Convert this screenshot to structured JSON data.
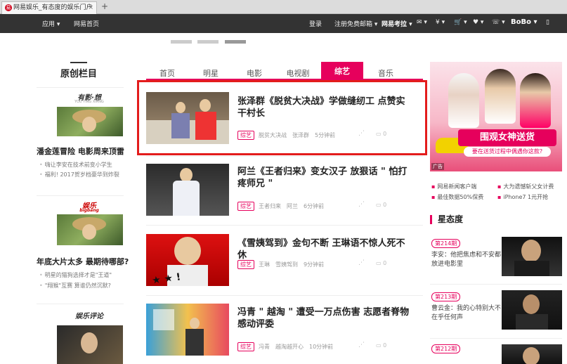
{
  "browser": {
    "tab_title": "网易娱乐_有态度的娱乐门户",
    "close": "×",
    "new_tab": "+"
  },
  "topnav": {
    "left": [
      "应用 ▾",
      "网易首页"
    ],
    "right": [
      "登录",
      "注册免费邮箱 ▾",
      "网易考拉 ▾",
      "✉ ▾",
      "¥ ▾",
      "🛒 ▾",
      "♥ ▾",
      "☏ ▾",
      "BoBo ▾",
      "▯"
    ]
  },
  "left": {
    "title": "原创栏目",
    "blocks": [
      {
        "logo": "有影·想",
        "logo_sub": "YOU YING XIANG",
        "title": "潘金莲冒险 电影周来顶雷",
        "links": [
          "嗨让李安在技术前变小学生",
          "福利! 2017贺岁档豪华到炸裂"
        ]
      },
      {
        "logo": "娱乐",
        "logo_sub": "bigbang",
        "title": "年底大片太多 最期待哪部?",
        "links": [
          "明星的猫狗选择才是\"王道\"",
          "\"翔猴\"互赛 算谁仍然沉默?"
        ]
      },
      {
        "logo": "娱乐评论",
        "logo_sub": "",
        "title": "",
        "links": []
      }
    ]
  },
  "tabs": [
    {
      "label": "首页"
    },
    {
      "label": "明星"
    },
    {
      "label": "电影"
    },
    {
      "label": "电视剧"
    },
    {
      "label": "综艺",
      "active": true
    },
    {
      "label": "音乐"
    }
  ],
  "articles": [
    {
      "title": "张泽群《脱贫大决战》学做缝纫工 点赞实干村长",
      "tag": "综艺",
      "meta": [
        "脱贫大决战",
        "张泽群",
        "5分钟前"
      ],
      "comments": "0",
      "highlighted": true
    },
    {
      "title": "阿兰《王者归来》变女汉子 放狠话 \" 怕打疼师兄 \"",
      "tag": "综艺",
      "meta": [
        "王者归来",
        "阿兰",
        "6分钟前"
      ],
      "comments": "0"
    },
    {
      "title": "《雪姨驾到》金句不断 王琳语不惊人死不休",
      "tag": "综艺",
      "meta": [
        "王琳",
        "雪姨驾到",
        "9分钟前"
      ],
      "comments": "0"
    },
    {
      "title": "冯青 \" 越淘 \" 遭受一万点伤害 志愿者脊物感动评委",
      "tag": "综艺",
      "meta": [
        "冯青",
        "越淘越开心",
        "10分钟前"
      ],
      "comments": "0"
    }
  ],
  "right": {
    "ad": {
      "banner": "围观女神送货",
      "sub": "要在送货过程中偶遇你这款?",
      "label": "广告"
    },
    "links": [
      "网易新闻客户端",
      "大为遗憾斩父女计费",
      "最佳数据50%保费",
      "iPhone7 1元开抢"
    ],
    "section_title": "星态度",
    "issues": [
      {
        "num": "第214期",
        "text": "李安：他把焦虑和不安都放进电影里"
      },
      {
        "num": "第213期",
        "text": "曹云金：我的心特别大不在乎任何声"
      },
      {
        "num": "第212期",
        "text": ""
      }
    ]
  },
  "colors": {
    "accent": "#e6005c",
    "highlight": "#e31c1c",
    "nav": "#333333"
  }
}
